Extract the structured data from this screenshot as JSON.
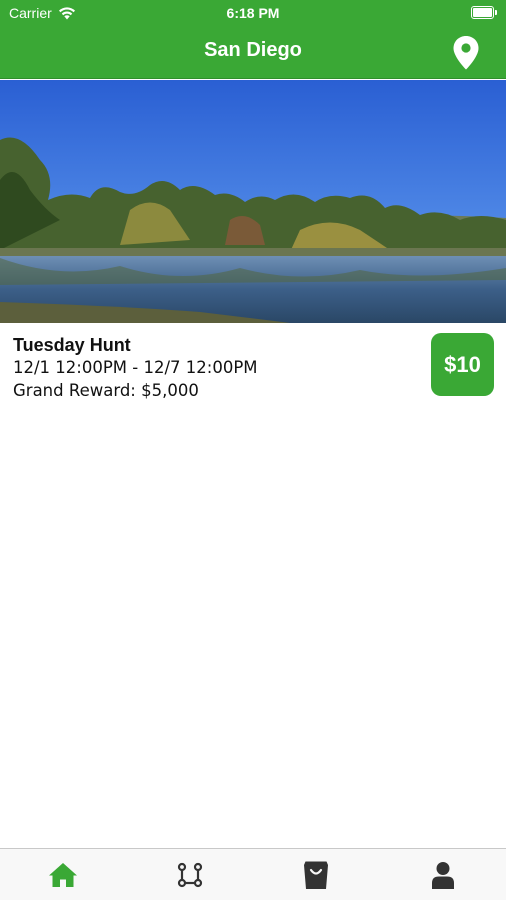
{
  "status_bar": {
    "carrier": "Carrier",
    "time": "6:18 PM"
  },
  "nav": {
    "title": "San Diego",
    "location_icon": "map-pin-icon"
  },
  "hunt": {
    "title": "Tuesday Hunt",
    "dates": "12/1 12:00PM - 12/7 12:00PM",
    "reward": "Grand Reward: $5,000",
    "price": "$10"
  },
  "tabs": [
    {
      "id": "home",
      "icon": "home-icon",
      "active": true
    },
    {
      "id": "route",
      "icon": "route-icon",
      "active": false
    },
    {
      "id": "shop",
      "icon": "shopping-bag-icon",
      "active": false
    },
    {
      "id": "profile",
      "icon": "person-icon",
      "active": false
    }
  ],
  "colors": {
    "brand_green": "#3aa835",
    "tab_inactive": "#333333"
  }
}
